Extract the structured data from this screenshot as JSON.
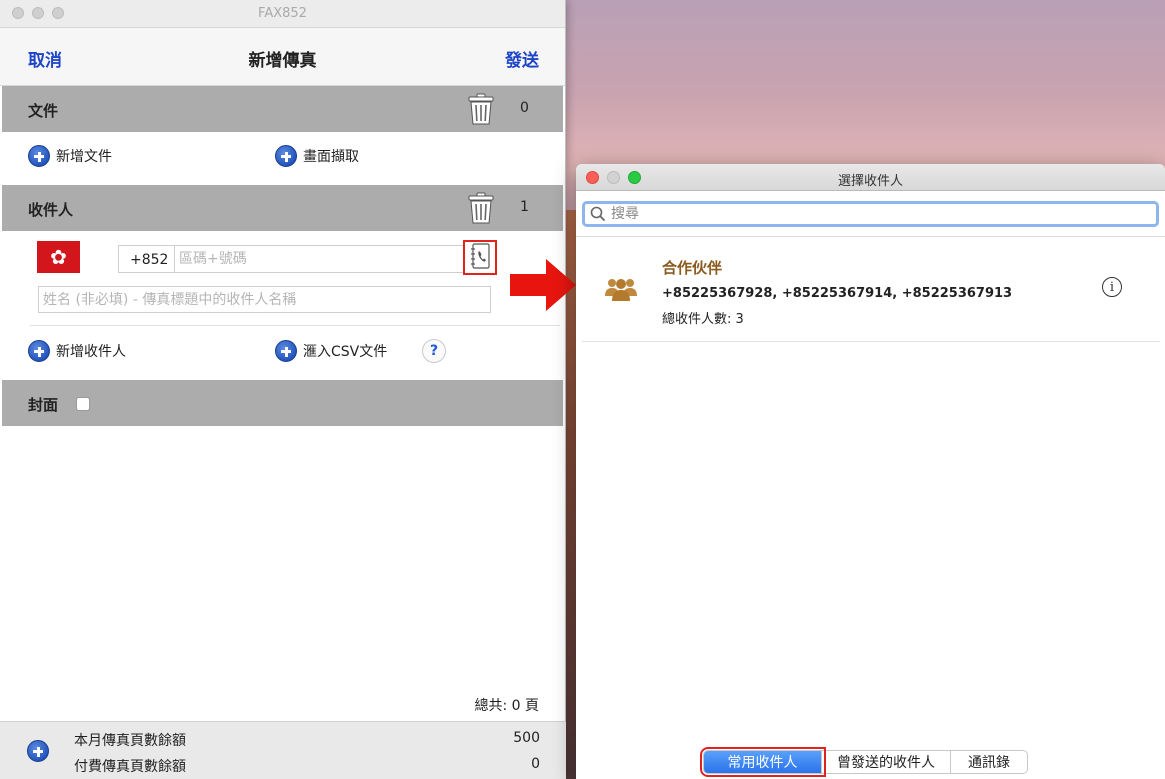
{
  "left_window": {
    "title": "FAX852",
    "nav": {
      "cancel": "取消",
      "title": "新增傳真",
      "send": "發送"
    },
    "documents": {
      "title": "文件",
      "count": "0",
      "actions": {
        "add_document": "新增文件",
        "screen_capture": "畫面擷取"
      }
    },
    "recipients": {
      "title": "收件人",
      "count": "1",
      "country_code": "+852",
      "number_placeholder": "區碼+號碼",
      "name_placeholder": "姓名 (非必填) - 傳真標題中的收件人名稱",
      "actions": {
        "add_recipient": "新增收件人",
        "import_csv": "滙入CSV文件"
      },
      "help": "?"
    },
    "cover": {
      "title": "封面"
    },
    "total_pages": "總共: 0 頁",
    "footer": {
      "monthly_label": "本月傳真頁數餘額",
      "monthly_value": "500",
      "paid_label": "付費傳真頁數餘額",
      "paid_value": "0"
    }
  },
  "right_window": {
    "title": "選擇收件人",
    "search_placeholder": "搜尋",
    "group": {
      "name": "合作伙伴",
      "numbers": "+85225367928, +85225367914, +85225367913",
      "total": "總收件人數: 3"
    },
    "tabs": {
      "favorites": "常用收件人",
      "sent": "曾發送的收件人",
      "address_book": "通訊錄"
    }
  },
  "colors": {
    "accent_blue": "#1e44c7",
    "highlight_red": "#e0231d",
    "group_brown": "#8a5a1e",
    "section_gray": "#acacac"
  },
  "icons": {
    "trash": "trash-icon",
    "plus": "plus-circle-icon",
    "contacts": "address-book-phone-icon",
    "flag": "hong-kong-flag-icon",
    "search": "magnifier-icon",
    "group": "people-group-icon",
    "info": "info-icon"
  }
}
